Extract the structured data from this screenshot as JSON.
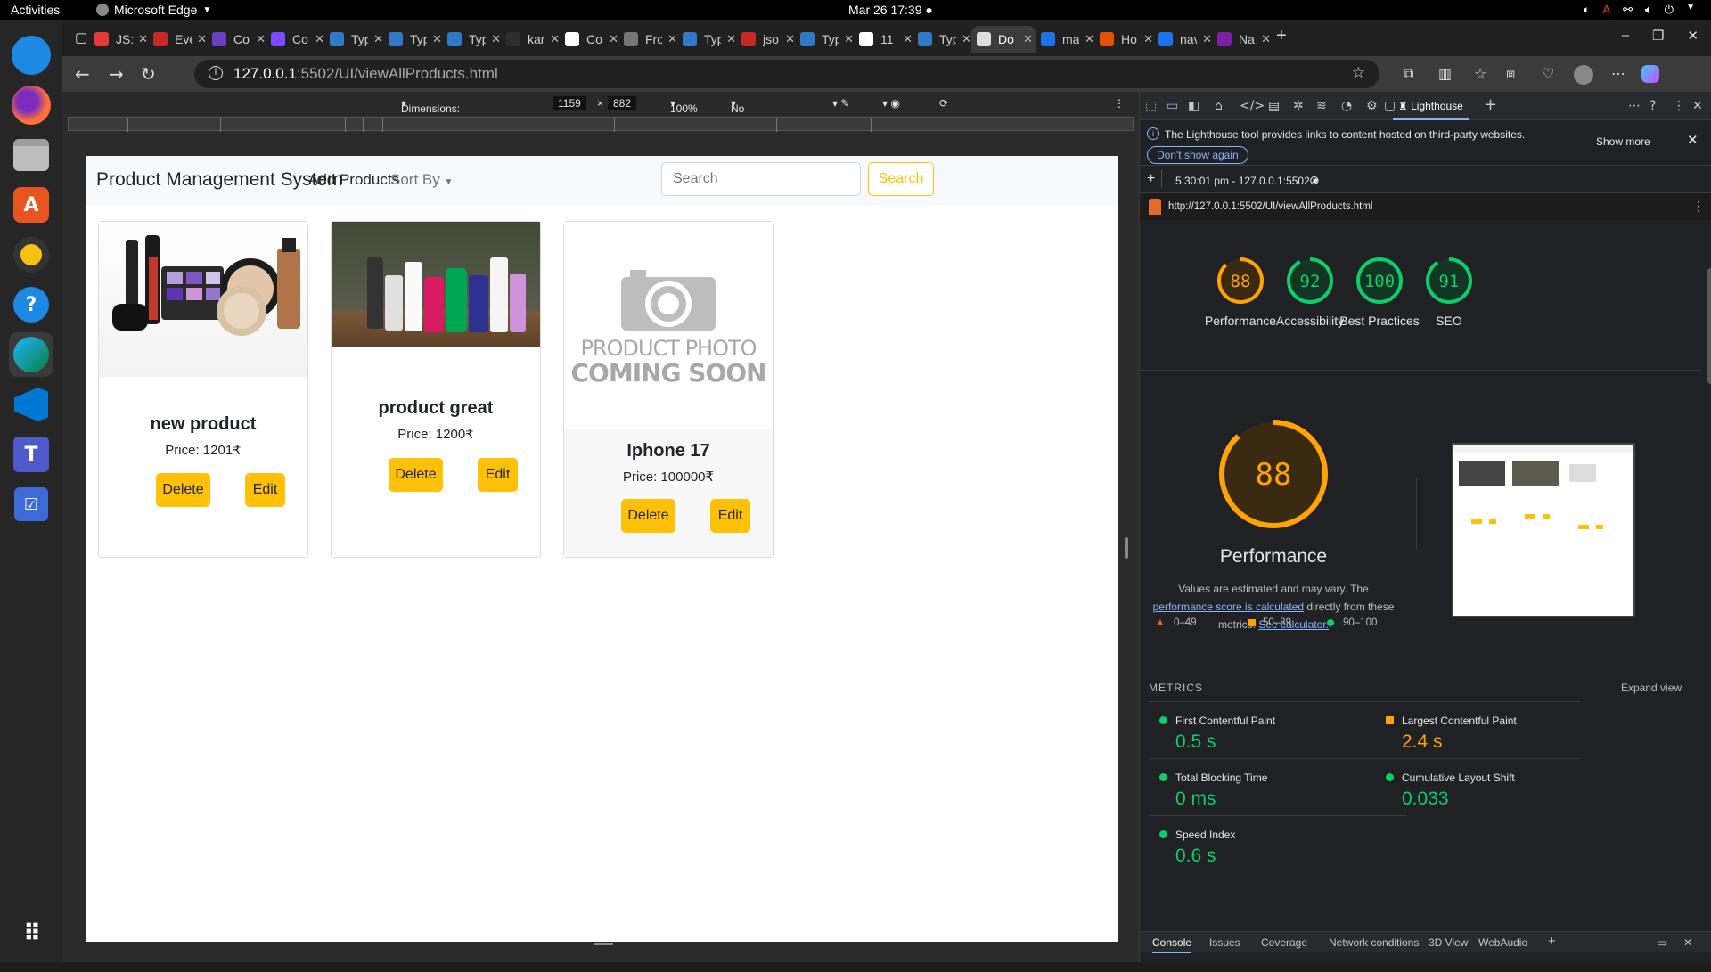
{
  "system": {
    "activities": "Activities",
    "app_name": "Microsoft Edge",
    "clock": "Mar 26  17:39"
  },
  "tabs": [
    {
      "label": "JS:",
      "color": "#e53935"
    },
    {
      "label": "Eve",
      "color": "#c62828"
    },
    {
      "label": "Co",
      "color": "#6a3fbf"
    },
    {
      "label": "Co",
      "color": "#7c4dff"
    },
    {
      "label": "Typ",
      "color": "#3178c6"
    },
    {
      "label": "Typ",
      "color": "#3178c6"
    },
    {
      "label": "Typ",
      "color": "#3178c6"
    },
    {
      "label": "kar",
      "color": "#2e2e2e"
    },
    {
      "label": "Co",
      "color": "#ffffff"
    },
    {
      "label": "Fro",
      "color": "#777777"
    },
    {
      "label": "Typ",
      "color": "#3178c6"
    },
    {
      "label": "jso",
      "color": "#c62828"
    },
    {
      "label": "Typ",
      "color": "#3178c6"
    },
    {
      "label": "11",
      "color": "#ffffff"
    },
    {
      "label": "Typ",
      "color": "#3178c6"
    },
    {
      "label": "Do",
      "color": "#dddddd",
      "active": true
    },
    {
      "label": "ma",
      "color": "#1a73e8"
    },
    {
      "label": "Ho",
      "color": "#e65100"
    },
    {
      "label": "nav",
      "color": "#1a73e8"
    },
    {
      "label": "Na",
      "color": "#7b1fa2"
    }
  ],
  "address": {
    "host": "127.0.0.1",
    "path": ":5502/UI/viewAllProducts.html"
  },
  "device_toolbar": {
    "dimensions": "Dimensions: Responsive",
    "width": "1159",
    "height": "882",
    "zoom": "100%",
    "throttling": "No throttling"
  },
  "app": {
    "brand": "Product Management System",
    "add_products": "Add Products",
    "sort_by": "Sort By",
    "search_placeholder": "Search",
    "search_button": "Search",
    "products": [
      {
        "name": "new product",
        "price": "Price: 1201₹",
        "delete": "Delete",
        "edit": "Edit",
        "image": "cosmetics"
      },
      {
        "name": "product great",
        "price": "Price: 1200₹",
        "delete": "Delete",
        "edit": "Edit",
        "image": "cleaning-bottles"
      },
      {
        "name": "Iphone 17",
        "price": "Price: 100000₹",
        "delete": "Delete",
        "edit": "Edit",
        "image": "placeholder-camera",
        "placeholder_line1": "PRODUCT PHOTO",
        "placeholder_line2": "COMING SOON"
      }
    ]
  },
  "devtools": {
    "active_tab": "Lighthouse",
    "info_text": "The Lighthouse tool provides links to content hosted on third-party websites.",
    "show_more": "Show more",
    "dont_show": "Don't show again",
    "report_time": "5:30:01 pm - 127.0.0.1:5502",
    "report_url": "http://127.0.0.1:5502/UI/viewAllProducts.html",
    "scores": [
      {
        "value": "88",
        "label": "Performance",
        "color": "#ffa400",
        "fraction": 0.88
      },
      {
        "value": "92",
        "label": "Accessibility",
        "color": "#0cce6b",
        "fraction": 0.92
      },
      {
        "value": "100",
        "label": "Best Practices",
        "color": "#0cce6b",
        "fraction": 1.0
      },
      {
        "value": "91",
        "label": "SEO",
        "color": "#0cce6b",
        "fraction": 0.91
      }
    ],
    "performance": {
      "score": "88",
      "fraction": 0.88,
      "title": "Performance",
      "desc1": "Values are estimated and may vary. The",
      "link1": "performance score is calculated",
      "desc2": "directly from these metrics.",
      "link2": "See calculator."
    },
    "legend": [
      "0–49",
      "50–89",
      "90–100"
    ],
    "metrics_heading": "METRICS",
    "expand_view": "Expand view",
    "metrics": [
      {
        "name": "First Contentful Paint",
        "value": "0.5 s",
        "color": "#0cce6b",
        "shape": "circle"
      },
      {
        "name": "Largest Contentful Paint",
        "value": "2.4 s",
        "color": "#ffa400",
        "shape": "square"
      },
      {
        "name": "Total Blocking Time",
        "value": "0 ms",
        "color": "#0cce6b",
        "shape": "circle"
      },
      {
        "name": "Cumulative Layout Shift",
        "value": "0.033",
        "color": "#0cce6b",
        "shape": "circle"
      },
      {
        "name": "Speed Index",
        "value": "0.6 s",
        "color": "#0cce6b",
        "shape": "circle"
      }
    ],
    "drawer_tabs": [
      "Console",
      "Issues",
      "Coverage",
      "Network conditions",
      "3D View",
      "WebAudio"
    ]
  }
}
